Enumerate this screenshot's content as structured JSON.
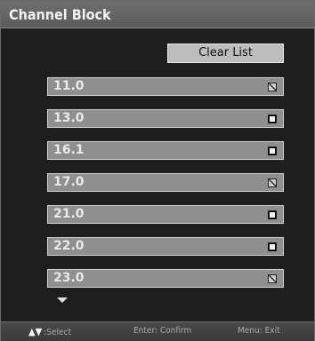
{
  "title": "Channel Block",
  "clear_button": "Clear List",
  "channels": [
    {
      "label": "11.0",
      "checked": true
    },
    {
      "label": "13.0",
      "checked": false
    },
    {
      "label": "16.1",
      "checked": false
    },
    {
      "label": "17.0",
      "checked": true
    },
    {
      "label": "21.0",
      "checked": false
    },
    {
      "label": "22.0",
      "checked": false
    },
    {
      "label": "23.0",
      "checked": true
    }
  ],
  "footer": {
    "arrows": "▲▼",
    "select": ":Select",
    "confirm": "Enter: Confirm",
    "exit": "Menu: Exit"
  },
  "icons": {
    "scroll": "scroll-down-icon",
    "checkbox": "checkbox-icon"
  },
  "colors": {
    "title_bar": "#666666",
    "background": "#1e1e1e",
    "row": "#8f8f8f",
    "button": "#bdbdbd"
  }
}
